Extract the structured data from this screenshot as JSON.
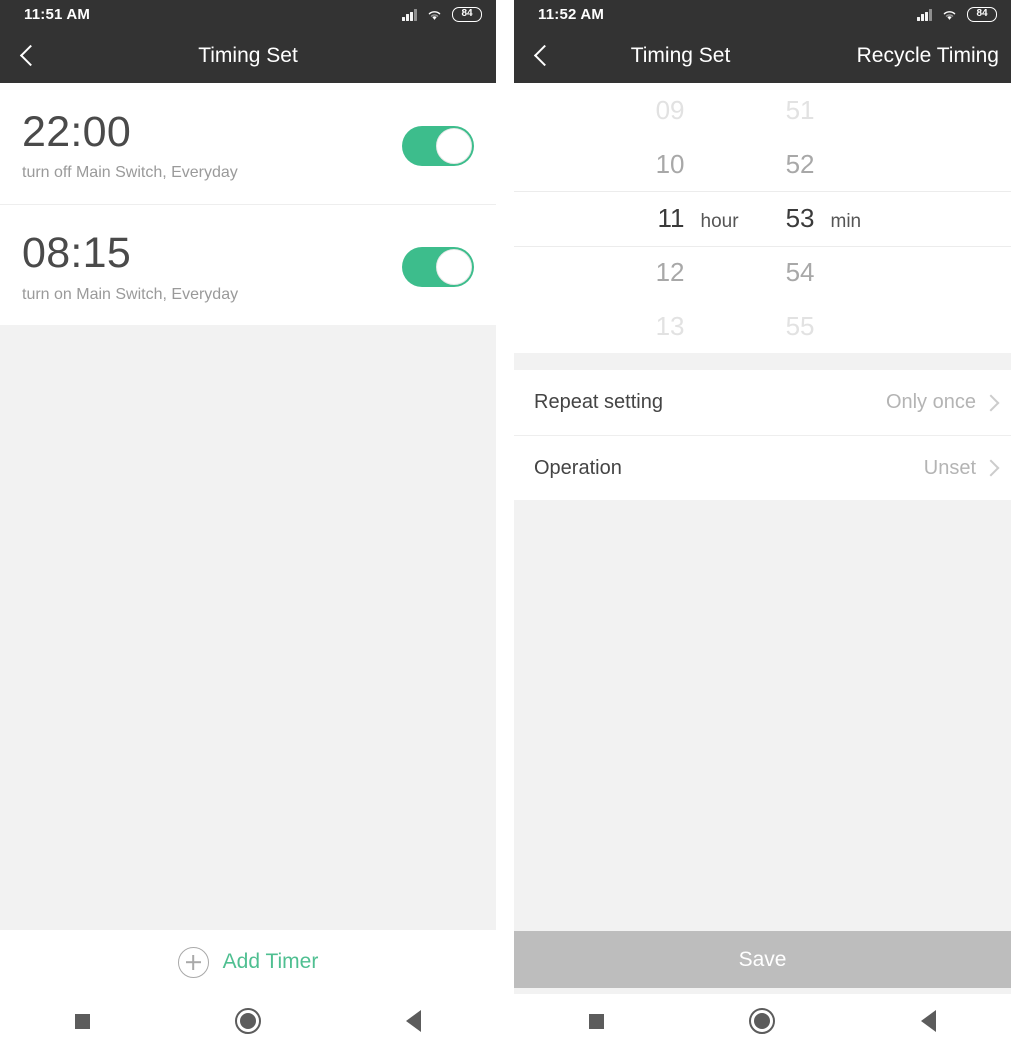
{
  "left": {
    "statusbar": {
      "time": "11:51 AM",
      "signal_icon": "signal-bars-icon",
      "wifi_icon": "wifi-icon",
      "battery_level": "84"
    },
    "appbar": {
      "back_icon": "chevron-left-icon",
      "title": "Timing Set"
    },
    "timers": [
      {
        "time": "22:00",
        "description": "turn off Main Switch, Everyday",
        "enabled": true
      },
      {
        "time": "08:15",
        "description": "turn on Main Switch, Everyday",
        "enabled": true
      }
    ],
    "add_timer": {
      "icon": "plus-circle-icon",
      "label": "Add Timer"
    }
  },
  "right": {
    "statusbar": {
      "time": "11:52 AM",
      "signal_icon": "signal-bars-icon",
      "wifi_icon": "wifi-icon",
      "battery_level": "84"
    },
    "appbar": {
      "back_icon": "chevron-left-icon",
      "title": "Timing Set",
      "action": "Recycle Timing"
    },
    "picker": {
      "hour_unit": "hour",
      "minute_unit": "min",
      "selected_hour": "11",
      "selected_minute": "53",
      "hours": [
        "09",
        "10",
        "11",
        "12",
        "13"
      ],
      "minutes": [
        "51",
        "52",
        "53",
        "54",
        "55"
      ]
    },
    "settings": [
      {
        "label": "Repeat setting",
        "value": "Only once",
        "chevron": "chevron-right-icon"
      },
      {
        "label": "Operation",
        "value": "Unset",
        "chevron": "chevron-right-icon"
      }
    ],
    "save": {
      "label": "Save"
    }
  },
  "navbar": {
    "recents_icon": "square-recents-icon",
    "home_icon": "circle-home-icon",
    "back_icon": "triangle-back-icon"
  },
  "colors": {
    "accent_green": "#3dbd8c",
    "add_timer_green": "#4fbf91",
    "appbar_dark": "#333333",
    "page_bg": "#f2f2f2",
    "save_disabled": "#bdbdbd"
  }
}
